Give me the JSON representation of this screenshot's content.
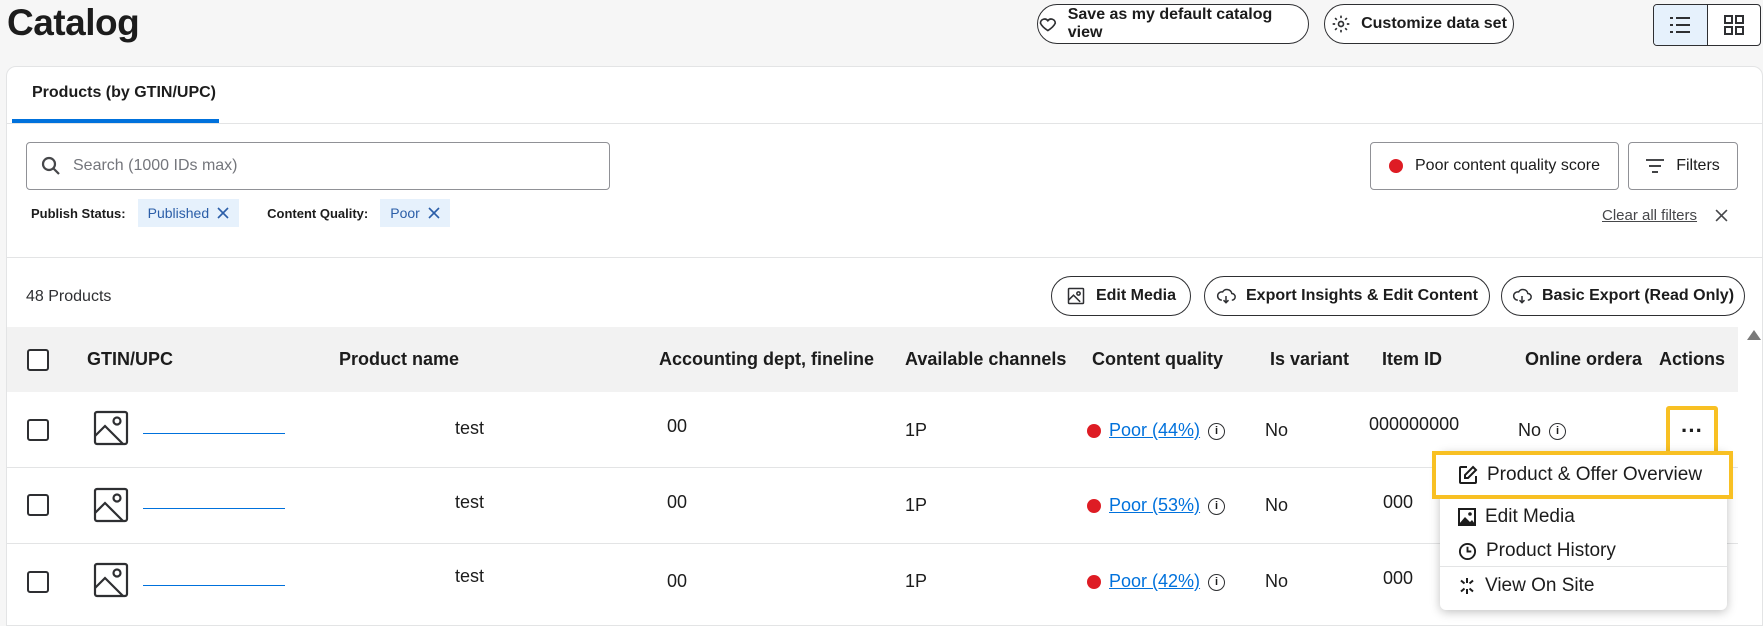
{
  "header": {
    "title": "Catalog",
    "save_view_label": "Save as my default catalog view",
    "customize_label": "Customize data set"
  },
  "tabs": [
    {
      "label": "Products (by GTIN/UPC)"
    }
  ],
  "search": {
    "placeholder": "Search (1000 IDs max)"
  },
  "quick_filter": {
    "label": "Poor content quality score",
    "color": "#de1c24"
  },
  "filters_label": "Filters",
  "active_filters": [
    {
      "label": "Publish Status:",
      "value": "Published"
    },
    {
      "label": "Content Quality:",
      "value": "Poor"
    }
  ],
  "clear_filters_label": "Clear all filters",
  "product_count": "48 Products",
  "toolbar": {
    "edit_media": "Edit Media",
    "export_insights": "Export Insights & Edit Content",
    "basic_export": "Basic Export (Read Only)"
  },
  "table": {
    "columns": [
      "GTIN/UPC",
      "Product name",
      "Accounting dept, fineline",
      "Available channels",
      "Content quality",
      "Is variant",
      "Item ID",
      "Online ordera",
      "Actions"
    ],
    "rows": [
      {
        "name": "test",
        "dept": "00",
        "channels": "1P",
        "quality": "Poor (44%)",
        "variant": "No",
        "item_id": "000000000",
        "online": "No"
      },
      {
        "name": "test",
        "dept": "00",
        "channels": "1P",
        "quality": "Poor (53%)",
        "variant": "No",
        "item_id": "000",
        "online": ""
      },
      {
        "name": "test",
        "dept": "00",
        "channels": "1P",
        "quality": "Poor (42%)",
        "variant": "No",
        "item_id": "000",
        "online": ""
      }
    ]
  },
  "actions_menu": {
    "items": [
      {
        "label": "Product & Offer Overview",
        "icon": "edit-icon"
      },
      {
        "label": "Edit Media",
        "icon": "image-icon"
      },
      {
        "label": "Product History",
        "icon": "clock-icon"
      },
      {
        "label": "View On Site",
        "icon": "spark-icon"
      }
    ]
  },
  "colors": {
    "accent": "#0071dc",
    "highlight": "#f8c023",
    "poor": "#de1c24"
  }
}
